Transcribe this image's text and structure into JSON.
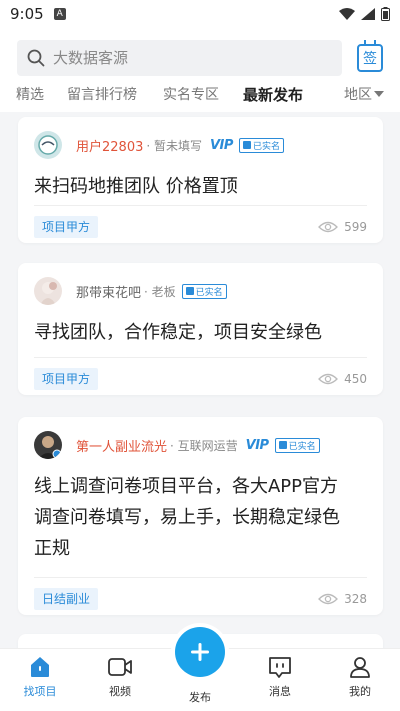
{
  "status_bar": {
    "time": "9:05",
    "notification_badge": "A"
  },
  "search": {
    "placeholder": "大数据客源"
  },
  "sign_in": {
    "label": "签"
  },
  "tabs": [
    {
      "label": "精选",
      "active": false
    },
    {
      "label": "留言排行榜",
      "active": false
    },
    {
      "label": "实名专区",
      "active": false
    },
    {
      "label": "最新发布",
      "active": true
    }
  ],
  "region": {
    "label": "地区"
  },
  "posts": [
    {
      "user": "用户22803",
      "role": "· 暂未填写",
      "vip": "VIP",
      "verified": "已实名",
      "title_lines": [
        "来扫码地推团队  价格置顶"
      ],
      "tag": "项目甲方",
      "views": "599"
    },
    {
      "user": "那带束花吧",
      "role": "· 老板",
      "vip": "",
      "verified": "已实名",
      "title_lines": [
        "寻找团队，合作稳定，项目安全绿色"
      ],
      "tag": "项目甲方",
      "views": "450"
    },
    {
      "user": "第一人副业流光",
      "role": "· 互联网运营",
      "vip": "VIP",
      "verified": "已实名",
      "title_lines": [
        "线上调查问卷项目平台，各大APP官方",
        "调查问卷填写，易上手，长期稳定绿色",
        "正规"
      ],
      "tag": "日结副业",
      "views": "328"
    }
  ],
  "nav": {
    "find_projects": "找项目",
    "video": "视频",
    "publish": "发布",
    "messages": "消息",
    "mine": "我的"
  },
  "colors": {
    "accent": "#2a8bd8",
    "publish": "#1ba3ea",
    "name_red": "#e0543a"
  }
}
